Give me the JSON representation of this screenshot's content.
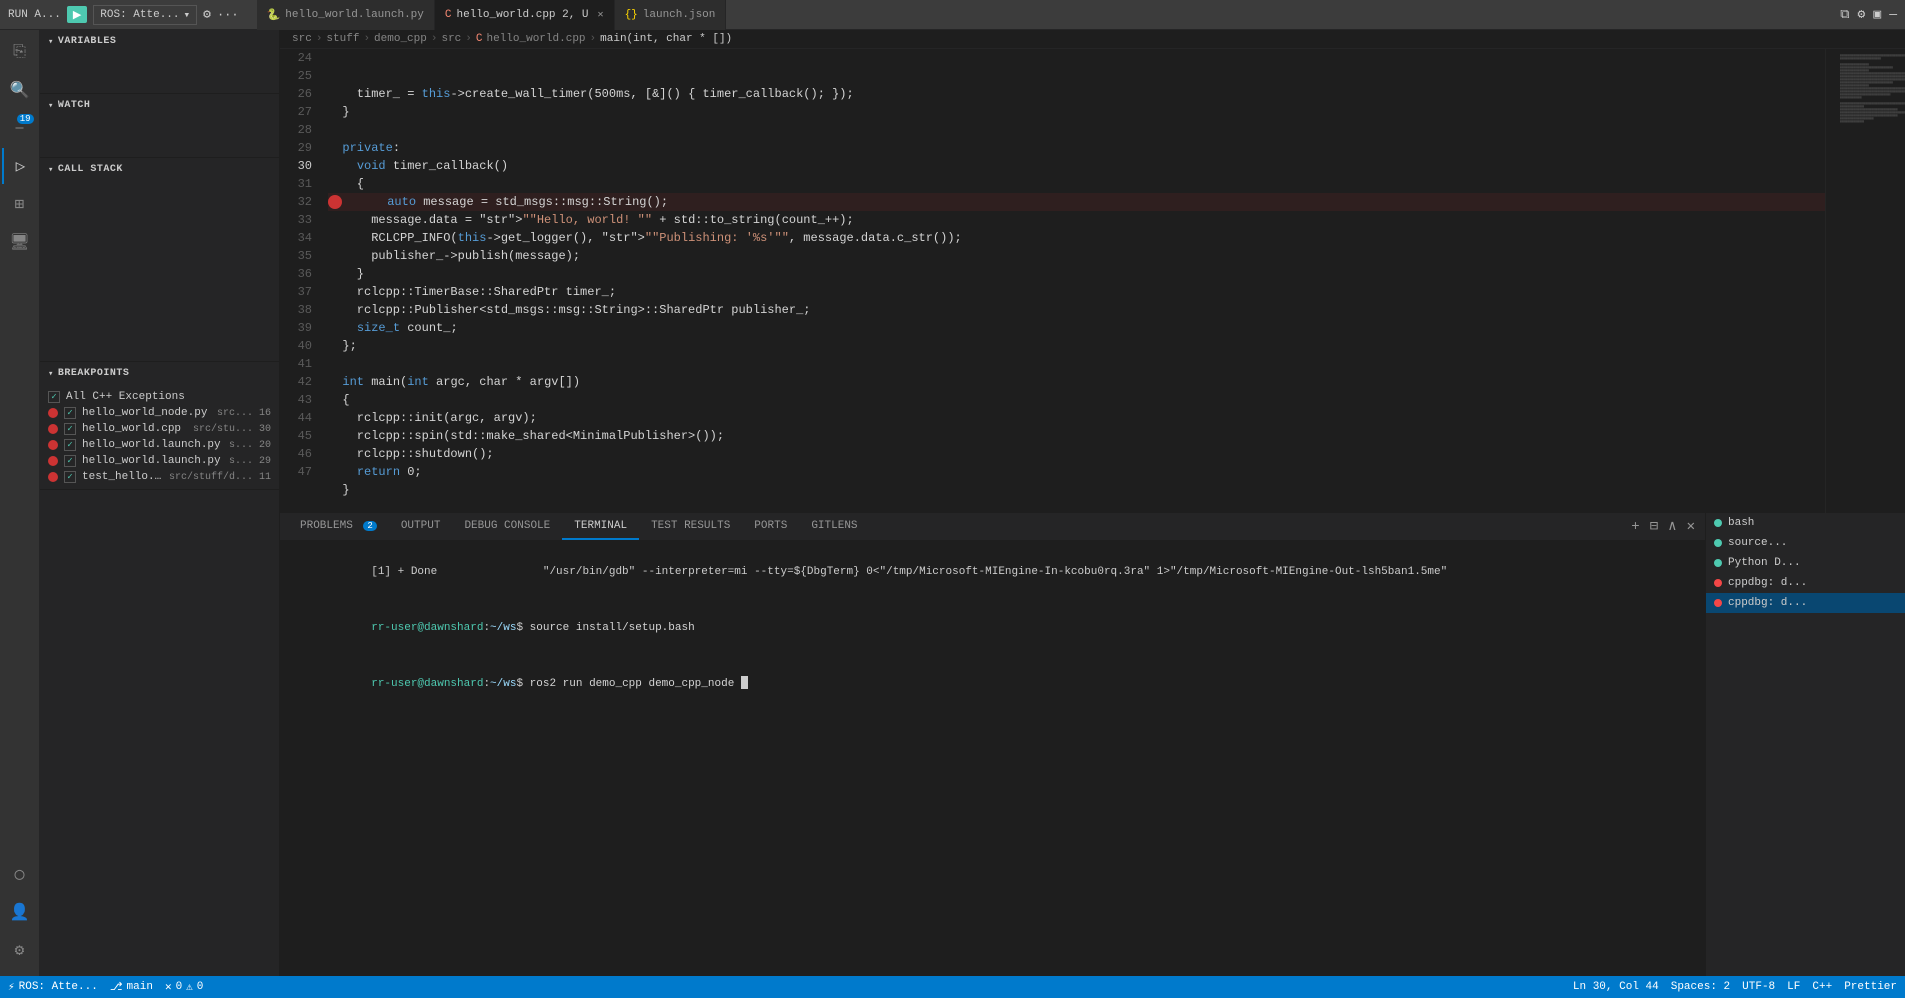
{
  "titlebar": {
    "run_label": "RUN A...",
    "play_label": "▶",
    "ros_label": "ROS: Atte...",
    "gear_icon": "⚙",
    "tabs": [
      {
        "id": "tab-py",
        "label": "hello_world.launch.py",
        "icon": "py",
        "active": false,
        "modified": false
      },
      {
        "id": "tab-cpp",
        "label": "hello_world.cpp",
        "icon": "cpp",
        "active": true,
        "modified": true,
        "extra": "2, U"
      },
      {
        "id": "tab-json",
        "label": "launch.json",
        "icon": "json",
        "active": false,
        "modified": false
      }
    ]
  },
  "breadcrumb": {
    "parts": [
      "src",
      "stuff",
      "demo_cpp",
      "src",
      "hello_world.cpp",
      "main(int, char * [])"
    ]
  },
  "sidebar": {
    "variables_label": "VARIABLES",
    "watch_label": "WATCH",
    "call_stack_label": "CALL STACK",
    "breakpoints_label": "BREAKPOINTS",
    "breakpoints": [
      {
        "filename": "All C++ Exceptions",
        "source": "",
        "line": "",
        "checked": true,
        "has_dot": false
      },
      {
        "filename": "hello_world_node.py",
        "source": "src...",
        "line": "16",
        "checked": true,
        "has_dot": true
      },
      {
        "filename": "hello_world.cpp",
        "source": "src/stu...",
        "line": "30",
        "checked": true,
        "has_dot": true
      },
      {
        "filename": "hello_world.launch.py",
        "source": "s...",
        "line": "20",
        "checked": true,
        "has_dot": true
      },
      {
        "filename": "hello_world.launch.py",
        "source": "s...",
        "line": "29",
        "checked": true,
        "has_dot": true
      },
      {
        "filename": "test_hello.py",
        "source": "src/stuff/d...",
        "line": "11",
        "checked": true,
        "has_dot": true
      }
    ]
  },
  "code": {
    "lines": [
      {
        "num": 24,
        "content": "    timer_ = this->create_wall_timer(500ms, [&]() { timer_callback(); });"
      },
      {
        "num": 25,
        "content": "  }"
      },
      {
        "num": 26,
        "content": ""
      },
      {
        "num": 27,
        "content": "  private:"
      },
      {
        "num": 28,
        "content": "    void timer_callback()"
      },
      {
        "num": 29,
        "content": "    {"
      },
      {
        "num": 30,
        "content": "      auto message = std_msgs::msg::String();",
        "breakpoint": true
      },
      {
        "num": 31,
        "content": "      message.data = \"Hello, world! \" + std::to_string(count_++);"
      },
      {
        "num": 32,
        "content": "      RCLCPP_INFO(this->get_logger(), \"Publishing: '%s'\", message.data.c_str());"
      },
      {
        "num": 33,
        "content": "      publisher_->publish(message);"
      },
      {
        "num": 34,
        "content": "    }"
      },
      {
        "num": 35,
        "content": "    rclcpp::TimerBase::SharedPtr timer_;"
      },
      {
        "num": 36,
        "content": "    rclcpp::Publisher<std_msgs::msg::String>::SharedPtr publisher_;"
      },
      {
        "num": 37,
        "content": "    size_t count_;"
      },
      {
        "num": 38,
        "content": "  };"
      },
      {
        "num": 39,
        "content": ""
      },
      {
        "num": 40,
        "content": "  int main(int argc, char * argv[])"
      },
      {
        "num": 41,
        "content": "  {"
      },
      {
        "num": 42,
        "content": "    rclcpp::init(argc, argv);"
      },
      {
        "num": 43,
        "content": "    rclcpp::spin(std::make_shared<MinimalPublisher>());"
      },
      {
        "num": 44,
        "content": "    rclcpp::shutdown();"
      },
      {
        "num": 45,
        "content": "    return 0;"
      },
      {
        "num": 46,
        "content": "  }"
      },
      {
        "num": 47,
        "content": ""
      }
    ]
  },
  "bottom": {
    "tabs": [
      {
        "id": "problems",
        "label": "PROBLEMS",
        "badge": "2",
        "active": false
      },
      {
        "id": "output",
        "label": "OUTPUT",
        "active": false
      },
      {
        "id": "debug-console",
        "label": "DEBUG CONSOLE",
        "active": false
      },
      {
        "id": "terminal",
        "label": "TERMINAL",
        "active": true
      },
      {
        "id": "test-results",
        "label": "TEST RESULTS",
        "active": false
      },
      {
        "id": "ports",
        "label": "PORTS",
        "active": false
      },
      {
        "id": "gitlens",
        "label": "GITLENS",
        "active": false
      }
    ],
    "terminal_lines": [
      {
        "text": "[1] + Done                \"/usr/bin/gdb\" --interpreter=mi --tty=${DbgTerm} 0<\"/tmp/Microsoft-MIEngine-In-kcobu0rq.3ra\" 1>\"/tmp/Microsoft-MIEngine-Out-lsh5ban1.5me\"",
        "dim": false
      },
      {
        "text": "rr-user@dawnshard:~/ws$ source install/setup.bash",
        "is_prompt": false,
        "dim": false
      },
      {
        "text": "rr-user@dawnshard:~/ws$ ros2 run demo_cpp demo_cpp_node ",
        "dim": false,
        "has_cursor": true
      }
    ],
    "right_tabs": [
      {
        "label": "bash",
        "active": false,
        "dot_color": "green"
      },
      {
        "label": "source...",
        "active": false,
        "dot_color": "green"
      },
      {
        "label": "Python D...",
        "active": false,
        "dot_color": "green"
      },
      {
        "label": "cppdbg: d...",
        "active": false,
        "dot_color": "red"
      },
      {
        "label": "cppdbg: d...",
        "active": true,
        "dot_color": "red"
      }
    ]
  },
  "status_bar": {
    "debug_icon": "⚡",
    "debug_label": "ROS: Atte...",
    "git_icon": "⎇",
    "git_label": "main",
    "error_icon": "✕",
    "error_count": "0",
    "warning_icon": "⚠",
    "warning_count": "0",
    "right_items": [
      "Ln 30, Col 44",
      "Spaces: 2",
      "UTF-8",
      "LF",
      "C++",
      "Prettier"
    ]
  },
  "activity_bar": {
    "icons": [
      {
        "name": "files",
        "symbol": "⎘",
        "active": false
      },
      {
        "name": "search",
        "symbol": "🔍",
        "active": false
      },
      {
        "name": "source-control",
        "symbol": "⎇",
        "active": false,
        "badge": "19"
      },
      {
        "name": "run-debug",
        "symbol": "▷",
        "active": true
      },
      {
        "name": "extensions",
        "symbol": "⊞",
        "active": false
      },
      {
        "name": "remote-explorer",
        "symbol": "🖥",
        "active": false
      },
      {
        "name": "ros",
        "symbol": "◎",
        "active": false
      },
      {
        "name": "settings-sync",
        "symbol": "↕",
        "active": false
      }
    ]
  }
}
